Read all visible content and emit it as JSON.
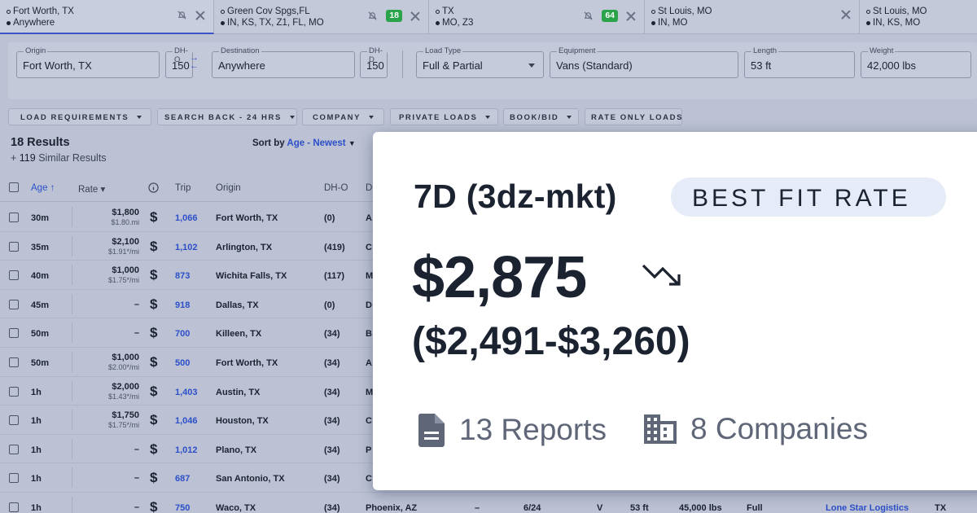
{
  "tabs": [
    {
      "line1": "Fort Worth, TX",
      "line2": "Anywhere",
      "badge": "",
      "active": true
    },
    {
      "line1": "Green Cov Spgs,FL",
      "line2": "IN, KS, TX, Z1, FL, MO",
      "badge": "18"
    },
    {
      "line1": "TX",
      "line2": "MO, Z3",
      "badge": "64"
    },
    {
      "line1": "St Louis, MO",
      "line2": "IN, MO",
      "badge": ""
    },
    {
      "line1": "St Louis, MO",
      "line2": "IN, KS, MO",
      "badge": ""
    }
  ],
  "search": {
    "origin_label": "Origin",
    "origin": "Fort Worth, TX",
    "dho_label": "DH-O",
    "dho": "150",
    "dest_label": "Destination",
    "dest": "Anywhere",
    "dhd_label": "DH-D",
    "dhd": "150",
    "loadtype_label": "Load Type",
    "loadtype": "Full & Partial",
    "equip_label": "Equipment",
    "equip": "Vans (Standard)",
    "length_label": "Length",
    "length": "53 ft",
    "weight_label": "Weight",
    "weight": "42,000 lbs"
  },
  "filters": [
    "LOAD REQUIREMENTS",
    "SEARCH BACK - 24 HRS",
    "COMPANY",
    "PRIVATE LOADS",
    "BOOK/BID",
    "RATE ONLY LOADS"
  ],
  "results": {
    "count": "18 Results",
    "similar_prefix": "+ ",
    "similar_count": "119",
    "similar_suffix": " Similar Results",
    "sort_prefix": "Sort by ",
    "sort_value": "Age - Newest"
  },
  "columns": {
    "age": "Age ↑",
    "rate": "Rate ▾",
    "trip": "Trip",
    "origin": "Origin",
    "dho": "DH-O",
    "dest": "D"
  },
  "rows": [
    {
      "age": "30m",
      "rate": "$1,800",
      "rate_mi": "$1.80.mi",
      "trip": "1,066",
      "origin": "Fort Worth, TX",
      "dho": "(0)",
      "dest": "A"
    },
    {
      "age": "35m",
      "rate": "$2,100",
      "rate_mi": "$1.91*/mi",
      "trip": "1,102",
      "origin": "Arlington, TX",
      "dho": "(419)",
      "dest": "C"
    },
    {
      "age": "40m",
      "rate": "$1,000",
      "rate_mi": "$1.75*/mi",
      "trip": "873",
      "origin": "Wichita Falls, TX",
      "dho": "(117)",
      "dest": "M"
    },
    {
      "age": "45m",
      "rate": "–",
      "rate_mi": "",
      "trip": "918",
      "origin": "Dallas, TX",
      "dho": "(0)",
      "dest": "D"
    },
    {
      "age": "50m",
      "rate": "–",
      "rate_mi": "",
      "trip": "700",
      "origin": "Killeen, TX",
      "dho": "(34)",
      "dest": "B"
    },
    {
      "age": "50m",
      "rate": "$1,000",
      "rate_mi": "$2.00*/mi",
      "trip": "500",
      "origin": "Fort Worth, TX",
      "dho": "(34)",
      "dest": "A"
    },
    {
      "age": "1h",
      "rate": "$2,000",
      "rate_mi": "$1.43*/mi",
      "trip": "1,403",
      "origin": "Austin, TX",
      "dho": "(34)",
      "dest": "M"
    },
    {
      "age": "1h",
      "rate": "$1,750",
      "rate_mi": "$1.75*/mi",
      "trip": "1,046",
      "origin": "Houston, TX",
      "dho": "(34)",
      "dest": "C"
    },
    {
      "age": "1h",
      "rate": "–",
      "rate_mi": "",
      "trip": "1,012",
      "origin": "Plano, TX",
      "dho": "(34)",
      "dest": "P"
    },
    {
      "age": "1h",
      "rate": "–",
      "rate_mi": "",
      "trip": "687",
      "origin": "San Antonio, TX",
      "dho": "(34)",
      "dest": "C"
    },
    {
      "age": "1h",
      "rate": "–",
      "rate_mi": "",
      "trip": "750",
      "origin": "Waco, TX",
      "dho": "(34)",
      "dest": "Phoenix, AZ"
    }
  ],
  "last_row_extra": {
    "dash": "–",
    "date": "6/24",
    "eq": "V",
    "length": "53 ft",
    "weight": "45,000 lbs",
    "fp": "Full",
    "company": "Lone Star Logistics",
    "state": "TX"
  },
  "card": {
    "title": "7D (3dz-mkt)",
    "pill": "BEST FIT RATE",
    "price": "$2,875",
    "range": "($2,491-$3,260)",
    "reports": "13 Reports",
    "companies": "8 Companies"
  },
  "colors": {
    "accent": "#2c4fc8",
    "badge": "#2aa34a",
    "pill_bg": "#e6ebf8"
  },
  "icons": {
    "reports": "document-icon",
    "companies": "building-icon",
    "trend": "trend-down-icon"
  }
}
